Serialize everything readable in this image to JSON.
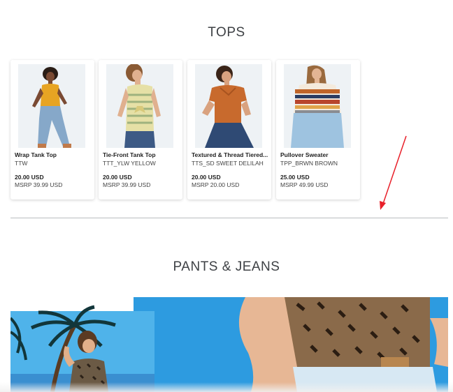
{
  "sections": {
    "tops_title": "TOPS",
    "pants_title": "PANTS & JEANS"
  },
  "products": [
    {
      "name": "Wrap Tank Top",
      "sku": "TTW",
      "price": "20.00 USD",
      "msrp": "MSRP 39.99 USD"
    },
    {
      "name": "Tie-Front Tank Top",
      "sku": "TTT_YLW YELLOW",
      "price": "20.00 USD",
      "msrp": "MSRP 39.99 USD"
    },
    {
      "name": "Textured & Thread Tiered...",
      "sku": "TTS_SD SWEET DELILAH",
      "price": "20.00 USD",
      "msrp": "MSRP 20.00 USD"
    },
    {
      "name": "Pullover Sweater",
      "sku": "TPP_BRWN BROWN",
      "price": "25.00 USD",
      "msrp": "MSRP 49.99 USD"
    }
  ],
  "colors": {
    "title_text": "#3e4145",
    "annotation_arrow": "#e8202a",
    "sky_blue": "#2e9fe0",
    "divider": "#b9bcbf"
  }
}
